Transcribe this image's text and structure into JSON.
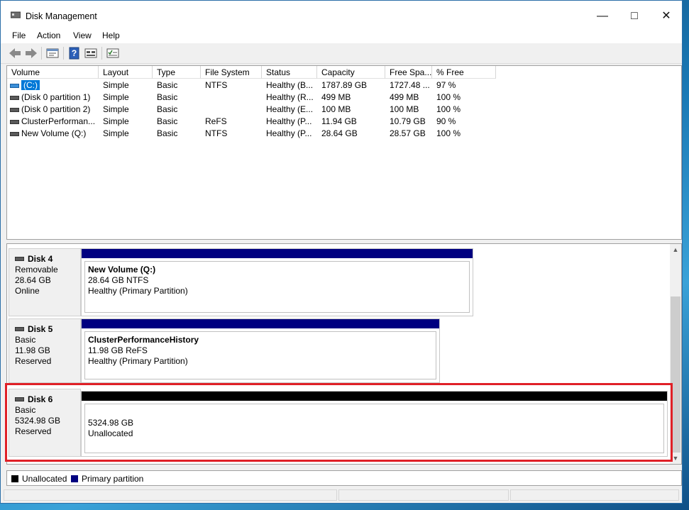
{
  "window": {
    "title": "Disk Management"
  },
  "menubar": {
    "items": [
      "File",
      "Action",
      "View",
      "Help"
    ]
  },
  "volume_list": {
    "columns": [
      "Volume",
      "Layout",
      "Type",
      "File System",
      "Status",
      "Capacity",
      "Free Spa...",
      "% Free"
    ],
    "rows": [
      {
        "volume": "(C:)",
        "layout": "Simple",
        "type": "Basic",
        "fs": "NTFS",
        "status": "Healthy (B...",
        "capacity": "1787.89 GB",
        "free": "1727.48 ...",
        "pct": "97 %"
      },
      {
        "volume": "(Disk 0 partition 1)",
        "layout": "Simple",
        "type": "Basic",
        "fs": "",
        "status": "Healthy (R...",
        "capacity": "499 MB",
        "free": "499 MB",
        "pct": "100 %"
      },
      {
        "volume": "(Disk 0 partition 2)",
        "layout": "Simple",
        "type": "Basic",
        "fs": "",
        "status": "Healthy (E...",
        "capacity": "100 MB",
        "free": "100 MB",
        "pct": "100 %"
      },
      {
        "volume": "ClusterPerforman...",
        "layout": "Simple",
        "type": "Basic",
        "fs": "ReFS",
        "status": "Healthy (P...",
        "capacity": "11.94 GB",
        "free": "10.79 GB",
        "pct": "90 %"
      },
      {
        "volume": "New Volume (Q:)",
        "layout": "Simple",
        "type": "Basic",
        "fs": "NTFS",
        "status": "Healthy (P...",
        "capacity": "28.64 GB",
        "free": "28.57 GB",
        "pct": "100 %"
      }
    ]
  },
  "disks": [
    {
      "name": "Disk 4",
      "kind": "Removable",
      "size": "28.64 GB",
      "state": "Online",
      "partition": {
        "title": "New Volume  (Q:)",
        "line2": "28.64 GB NTFS",
        "line3": "Healthy (Primary Partition)"
      }
    },
    {
      "name": "Disk 5",
      "kind": "Basic",
      "size": "11.98 GB",
      "state": "Reserved",
      "partition": {
        "title": "ClusterPerformanceHistory",
        "line2": "11.98 GB ReFS",
        "line3": "Healthy (Primary Partition)"
      }
    },
    {
      "name": "Disk 6",
      "kind": "Basic",
      "size": "5324.98 GB",
      "state": "Reserved",
      "partition": {
        "title": "",
        "line2": "5324.98 GB",
        "line3": "Unallocated"
      }
    }
  ],
  "legend": {
    "unallocated": "Unallocated",
    "primary": "Primary partition"
  },
  "colors": {
    "primary_partition": "#000080",
    "unallocated": "#000000",
    "highlight": "#e02027"
  },
  "icons": {
    "back": "arrow-left-icon",
    "forward": "arrow-right-icon",
    "help": "help-icon"
  }
}
